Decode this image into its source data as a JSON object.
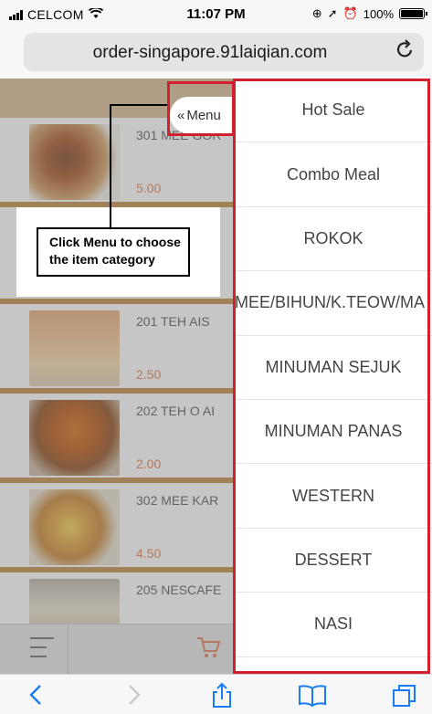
{
  "status_bar": {
    "carrier": "CELCOM",
    "time": "11:07 PM",
    "battery_text": "100%"
  },
  "browser": {
    "url": "order-singapore.91laiqian.com"
  },
  "menu_toggle": {
    "label": "Menu"
  },
  "items": [
    {
      "name": "301 MEE GOR",
      "price": "5.00"
    },
    {
      "name": "201 TEH AIS",
      "price": "2.50"
    },
    {
      "name": "202 TEH O AI",
      "price": "2.00"
    },
    {
      "name": "302 MEE KAR",
      "price": "4.50"
    },
    {
      "name": "205 NESCAFE",
      "price": ""
    }
  ],
  "categories": [
    "Hot Sale",
    "Combo Meal",
    "ROKOK",
    "MEE/BIHUN/K.TEOW/MA",
    "MINUMAN SEJUK",
    "MINUMAN PANAS",
    "WESTERN",
    "DESSERT",
    "NASI"
  ],
  "callout": {
    "line1": "Click Menu to choose",
    "line2": "the item category"
  },
  "colors": {
    "highlight": "#d3202f",
    "price": "#e07b50",
    "header": "#d7b891"
  }
}
